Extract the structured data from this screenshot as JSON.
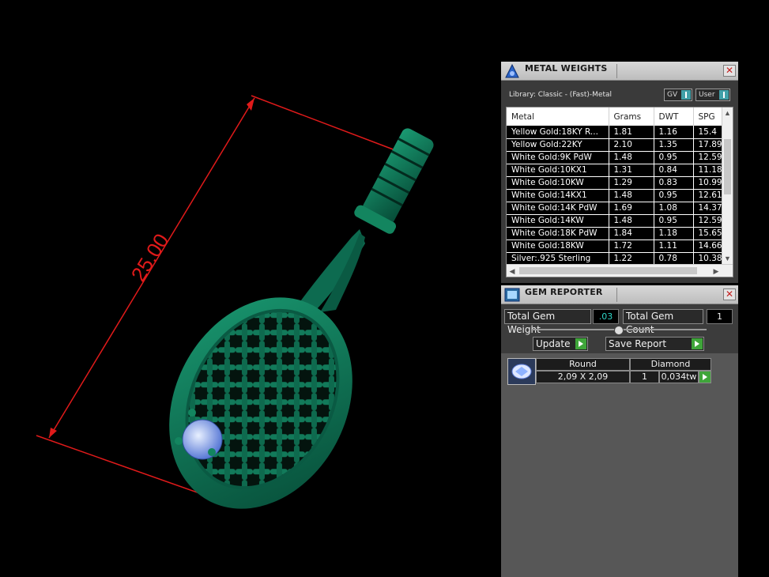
{
  "viewport": {
    "dimension_value": "25.00",
    "colors": {
      "racket": "#0d6b50",
      "dimension": "#e01a1a",
      "gem": "#8fb3ff"
    }
  },
  "metal_weights": {
    "title": "METAL WEIGHTS",
    "library": "Library: Classic - (Fast)-Metal",
    "toggle_gv": "GV",
    "toggle_user": "User",
    "columns": [
      "Metal",
      "Grams",
      "DWT",
      "SPG"
    ],
    "rows": [
      [
        "Yellow Gold:18KY R...",
        "1.81",
        "1.16",
        "15.4"
      ],
      [
        "Yellow Gold:22KY",
        "2.10",
        "1.35",
        "17.89"
      ],
      [
        "White Gold:9K PdW",
        "1.48",
        "0.95",
        "12.59"
      ],
      [
        "White Gold:10KX1",
        "1.31",
        "0.84",
        "11.18"
      ],
      [
        "White Gold:10KW",
        "1.29",
        "0.83",
        "10.99"
      ],
      [
        "White Gold:14KX1",
        "1.48",
        "0.95",
        "12.61"
      ],
      [
        "White Gold:14K PdW",
        "1.69",
        "1.08",
        "14.37"
      ],
      [
        "White Gold:14KW",
        "1.48",
        "0.95",
        "12.59"
      ],
      [
        "White Gold:18K PdW",
        "1.84",
        "1.18",
        "15.65"
      ],
      [
        "White Gold:18KW",
        "1.72",
        "1.11",
        "14.66"
      ],
      [
        "Silver:.925 Sterling",
        "1.22",
        "0.78",
        "10.38"
      ]
    ]
  },
  "gem_reporter": {
    "title": "GEM REPORTER",
    "total_weight_label": "Total Gem Weight",
    "total_weight_value": ".03",
    "total_count_label": "Total Gem Count",
    "total_count_value": "1",
    "update_label": "Update",
    "save_report_label": "Save Report",
    "gem": {
      "shape": "Round",
      "material": "Diamond",
      "size": "2,09 X 2,09",
      "count": "1",
      "weight": "0,034tw"
    }
  }
}
